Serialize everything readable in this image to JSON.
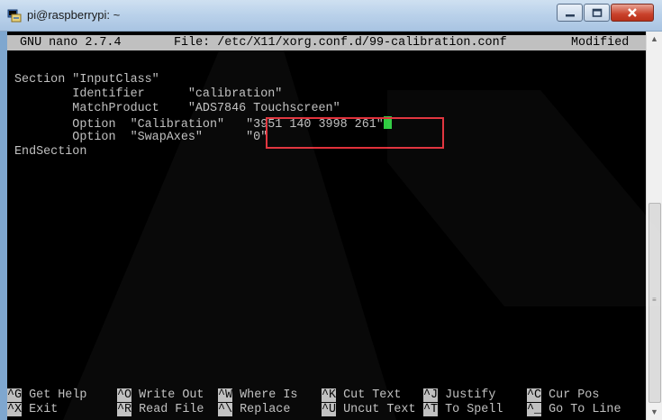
{
  "window": {
    "title": "pi@raspberrypi: ~",
    "icons": {
      "app": "putty-terminal-icon",
      "minimize": "minimize-icon",
      "maximize": "maximize-icon",
      "close": "close-icon"
    }
  },
  "nano": {
    "version": "GNU nano 2.7.4",
    "file": "File: /etc/X11/xorg.conf.d/99-calibration.conf",
    "status": "Modified"
  },
  "content": {
    "lines": [
      "Section \"InputClass\"",
      "        Identifier      \"calibration\"",
      "        MatchProduct    \"ADS7846 Touchscreen\"",
      "        Option  \"Calibration\"   \"3951 140 3998 261\"",
      "        Option  \"SwapAxes\"      \"0\"",
      "EndSection"
    ]
  },
  "shortcuts": {
    "row1": [
      {
        "key": "^G",
        "label": "Get Help"
      },
      {
        "key": "^O",
        "label": "Write Out"
      },
      {
        "key": "^W",
        "label": "Where Is"
      },
      {
        "key": "^K",
        "label": "Cut Text"
      },
      {
        "key": "^J",
        "label": "Justify"
      },
      {
        "key": "^C",
        "label": "Cur Pos"
      }
    ],
    "row2": [
      {
        "key": "^X",
        "label": "Exit"
      },
      {
        "key": "^R",
        "label": "Read File"
      },
      {
        "key": "^\\",
        "label": "Replace"
      },
      {
        "key": "^U",
        "label": "Uncut Text"
      },
      {
        "key": "^T",
        "label": "To Spell"
      },
      {
        "key": "^_",
        "label": "Go To Line"
      }
    ]
  },
  "colors": {
    "cursor": "#2ecc40",
    "highlight_box": "#e0303a",
    "terminal_bg": "#000000"
  }
}
